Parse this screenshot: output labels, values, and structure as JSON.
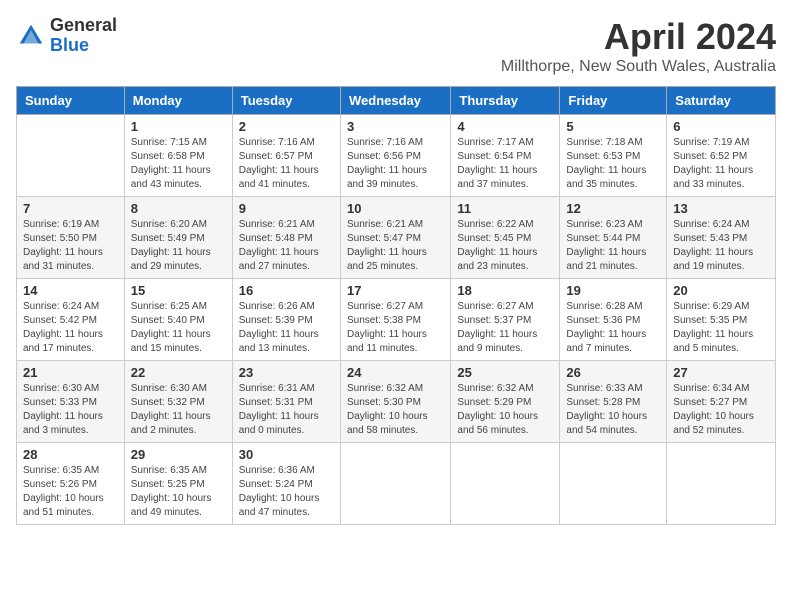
{
  "logo": {
    "general": "General",
    "blue": "Blue"
  },
  "title": "April 2024",
  "subtitle": "Millthorpe, New South Wales, Australia",
  "weekdays": [
    "Sunday",
    "Monday",
    "Tuesday",
    "Wednesday",
    "Thursday",
    "Friday",
    "Saturday"
  ],
  "weeks": [
    [
      {
        "day": "",
        "sunrise": "",
        "sunset": "",
        "daylight": ""
      },
      {
        "day": "1",
        "sunrise": "Sunrise: 7:15 AM",
        "sunset": "Sunset: 6:58 PM",
        "daylight": "Daylight: 11 hours and 43 minutes."
      },
      {
        "day": "2",
        "sunrise": "Sunrise: 7:16 AM",
        "sunset": "Sunset: 6:57 PM",
        "daylight": "Daylight: 11 hours and 41 minutes."
      },
      {
        "day": "3",
        "sunrise": "Sunrise: 7:16 AM",
        "sunset": "Sunset: 6:56 PM",
        "daylight": "Daylight: 11 hours and 39 minutes."
      },
      {
        "day": "4",
        "sunrise": "Sunrise: 7:17 AM",
        "sunset": "Sunset: 6:54 PM",
        "daylight": "Daylight: 11 hours and 37 minutes."
      },
      {
        "day": "5",
        "sunrise": "Sunrise: 7:18 AM",
        "sunset": "Sunset: 6:53 PM",
        "daylight": "Daylight: 11 hours and 35 minutes."
      },
      {
        "day": "6",
        "sunrise": "Sunrise: 7:19 AM",
        "sunset": "Sunset: 6:52 PM",
        "daylight": "Daylight: 11 hours and 33 minutes."
      }
    ],
    [
      {
        "day": "7",
        "sunrise": "Sunrise: 6:19 AM",
        "sunset": "Sunset: 5:50 PM",
        "daylight": "Daylight: 11 hours and 31 minutes."
      },
      {
        "day": "8",
        "sunrise": "Sunrise: 6:20 AM",
        "sunset": "Sunset: 5:49 PM",
        "daylight": "Daylight: 11 hours and 29 minutes."
      },
      {
        "day": "9",
        "sunrise": "Sunrise: 6:21 AM",
        "sunset": "Sunset: 5:48 PM",
        "daylight": "Daylight: 11 hours and 27 minutes."
      },
      {
        "day": "10",
        "sunrise": "Sunrise: 6:21 AM",
        "sunset": "Sunset: 5:47 PM",
        "daylight": "Daylight: 11 hours and 25 minutes."
      },
      {
        "day": "11",
        "sunrise": "Sunrise: 6:22 AM",
        "sunset": "Sunset: 5:45 PM",
        "daylight": "Daylight: 11 hours and 23 minutes."
      },
      {
        "day": "12",
        "sunrise": "Sunrise: 6:23 AM",
        "sunset": "Sunset: 5:44 PM",
        "daylight": "Daylight: 11 hours and 21 minutes."
      },
      {
        "day": "13",
        "sunrise": "Sunrise: 6:24 AM",
        "sunset": "Sunset: 5:43 PM",
        "daylight": "Daylight: 11 hours and 19 minutes."
      }
    ],
    [
      {
        "day": "14",
        "sunrise": "Sunrise: 6:24 AM",
        "sunset": "Sunset: 5:42 PM",
        "daylight": "Daylight: 11 hours and 17 minutes."
      },
      {
        "day": "15",
        "sunrise": "Sunrise: 6:25 AM",
        "sunset": "Sunset: 5:40 PM",
        "daylight": "Daylight: 11 hours and 15 minutes."
      },
      {
        "day": "16",
        "sunrise": "Sunrise: 6:26 AM",
        "sunset": "Sunset: 5:39 PM",
        "daylight": "Daylight: 11 hours and 13 minutes."
      },
      {
        "day": "17",
        "sunrise": "Sunrise: 6:27 AM",
        "sunset": "Sunset: 5:38 PM",
        "daylight": "Daylight: 11 hours and 11 minutes."
      },
      {
        "day": "18",
        "sunrise": "Sunrise: 6:27 AM",
        "sunset": "Sunset: 5:37 PM",
        "daylight": "Daylight: 11 hours and 9 minutes."
      },
      {
        "day": "19",
        "sunrise": "Sunrise: 6:28 AM",
        "sunset": "Sunset: 5:36 PM",
        "daylight": "Daylight: 11 hours and 7 minutes."
      },
      {
        "day": "20",
        "sunrise": "Sunrise: 6:29 AM",
        "sunset": "Sunset: 5:35 PM",
        "daylight": "Daylight: 11 hours and 5 minutes."
      }
    ],
    [
      {
        "day": "21",
        "sunrise": "Sunrise: 6:30 AM",
        "sunset": "Sunset: 5:33 PM",
        "daylight": "Daylight: 11 hours and 3 minutes."
      },
      {
        "day": "22",
        "sunrise": "Sunrise: 6:30 AM",
        "sunset": "Sunset: 5:32 PM",
        "daylight": "Daylight: 11 hours and 2 minutes."
      },
      {
        "day": "23",
        "sunrise": "Sunrise: 6:31 AM",
        "sunset": "Sunset: 5:31 PM",
        "daylight": "Daylight: 11 hours and 0 minutes."
      },
      {
        "day": "24",
        "sunrise": "Sunrise: 6:32 AM",
        "sunset": "Sunset: 5:30 PM",
        "daylight": "Daylight: 10 hours and 58 minutes."
      },
      {
        "day": "25",
        "sunrise": "Sunrise: 6:32 AM",
        "sunset": "Sunset: 5:29 PM",
        "daylight": "Daylight: 10 hours and 56 minutes."
      },
      {
        "day": "26",
        "sunrise": "Sunrise: 6:33 AM",
        "sunset": "Sunset: 5:28 PM",
        "daylight": "Daylight: 10 hours and 54 minutes."
      },
      {
        "day": "27",
        "sunrise": "Sunrise: 6:34 AM",
        "sunset": "Sunset: 5:27 PM",
        "daylight": "Daylight: 10 hours and 52 minutes."
      }
    ],
    [
      {
        "day": "28",
        "sunrise": "Sunrise: 6:35 AM",
        "sunset": "Sunset: 5:26 PM",
        "daylight": "Daylight: 10 hours and 51 minutes."
      },
      {
        "day": "29",
        "sunrise": "Sunrise: 6:35 AM",
        "sunset": "Sunset: 5:25 PM",
        "daylight": "Daylight: 10 hours and 49 minutes."
      },
      {
        "day": "30",
        "sunrise": "Sunrise: 6:36 AM",
        "sunset": "Sunset: 5:24 PM",
        "daylight": "Daylight: 10 hours and 47 minutes."
      },
      {
        "day": "",
        "sunrise": "",
        "sunset": "",
        "daylight": ""
      },
      {
        "day": "",
        "sunrise": "",
        "sunset": "",
        "daylight": ""
      },
      {
        "day": "",
        "sunrise": "",
        "sunset": "",
        "daylight": ""
      },
      {
        "day": "",
        "sunrise": "",
        "sunset": "",
        "daylight": ""
      }
    ]
  ]
}
